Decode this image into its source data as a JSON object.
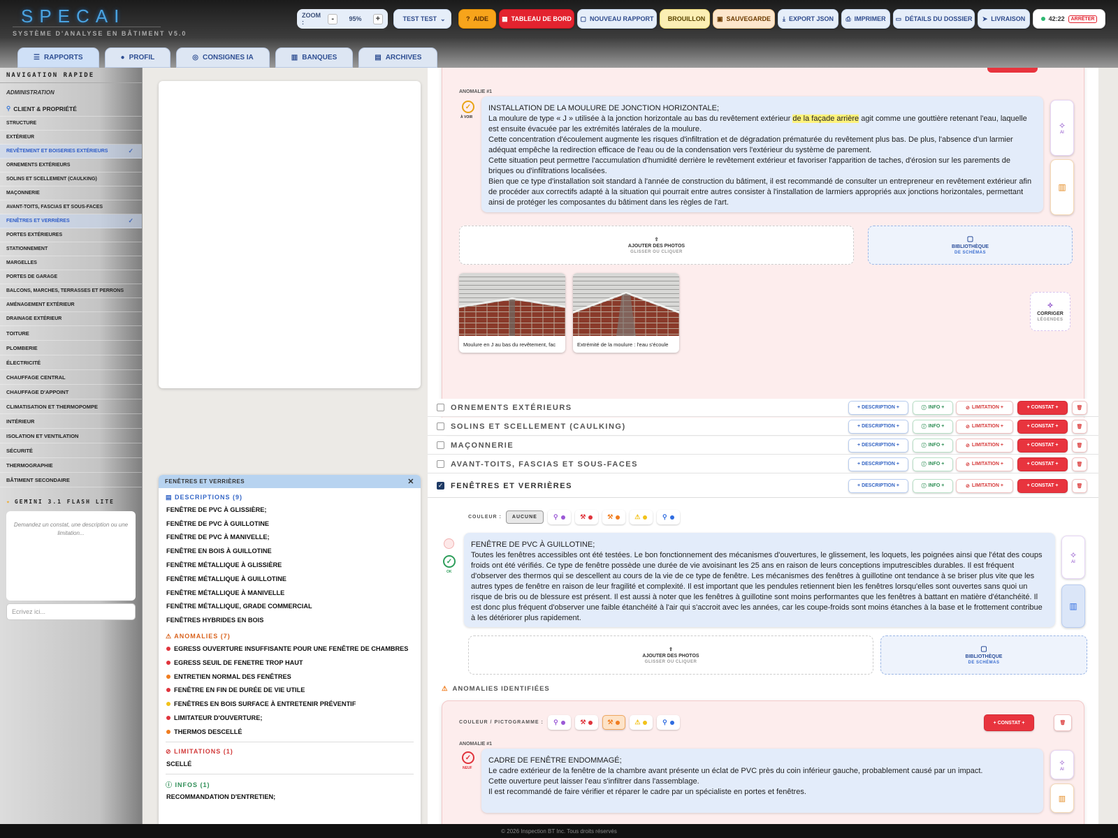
{
  "app": {
    "logo": "SPECAI",
    "subtitle": "SYSTÈME D'ANALYSE EN BÂTIMENT V5.0",
    "footer": "© 2026 Inspection BT Inc. Tous droits réservés"
  },
  "toolbar": {
    "zoom_label": "ZOOM :",
    "zoom_minus": "-",
    "zoom_value": "95%",
    "zoom_plus": "+",
    "user": "TEST TEST",
    "aide": "AIDE",
    "tableau": "TABLEAU DE BORD",
    "nouveau": "NOUVEAU RAPPORT",
    "brouillon": "BROUILLON",
    "sauvegarde": "SAUVEGARDE",
    "export": "EXPORT JSON",
    "imprimer": "IMPRIMER",
    "details": "DÉTAILS DU DOSSIER",
    "livraison": "LIVRAISON",
    "timer": "42:22",
    "arreter": "ARRÊTER"
  },
  "tabs": [
    {
      "label": "RAPPORTS"
    },
    {
      "label": "PROFIL"
    },
    {
      "label": "CONSIGNES IA"
    },
    {
      "label": "BANQUES"
    },
    {
      "label": "ARCHIVES"
    }
  ],
  "sidebar": {
    "title": "NAVIGATION RAPIDE",
    "section": "ADMINISTRATION",
    "items": [
      "CLIENT & PROPRIÉTÉ",
      "STRUCTURE",
      "EXTÉRIEUR",
      "REVÊTEMENT ET BOISERIES EXTÉRIEURS",
      "ORNEMENTS EXTÉRIEURS",
      "SOLINS ET SCELLEMENT (CAULKING)",
      "MAÇONNERIE",
      "AVANT-TOITS, FASCIAS ET SOUS-FACES",
      "FENÊTRES ET VERRIÈRES",
      "PORTES EXTÉRIEURES",
      "STATIONNEMENT",
      "MARGELLES",
      "PORTES DE GARAGE",
      "BALCONS, MARCHES, TERRASSES ET PERRONS",
      "AMÉNAGEMENT EXTÉRIEUR",
      "DRAINAGE EXTÉRIEUR",
      "TOITURE",
      "PLOMBERIE",
      "ÉLECTRICITÉ",
      "CHAUFFAGE CENTRAL",
      "CHAUFFAGE D'APPOINT",
      "CLIMATISATION ET THERMOPOMPE",
      "INTÉRIEUR",
      "ISOLATION ET VENTILATION",
      "SÉCURITÉ",
      "THERMOGRAPHIE",
      "BÂTIMENT SECONDAIRE"
    ],
    "ai_title": "GEMINI 3.1 FLASH LITE",
    "ai_placeholder": "Demandez un constat, une description ou une limitation...",
    "ai_input": "Ecrivez ici..."
  },
  "quick": {
    "title": "FENÊTRES ET VERRIÈRES",
    "desc_title": "DESCRIPTIONS (9)",
    "descriptions": [
      "FENÊTRE DE PVC À GLISSIÈRE;",
      "FENÊTRE DE PVC À GUILLOTINE",
      "FENÊTRE DE PVC À MANIVELLE;",
      "FENÊTRE EN BOIS À GUILLOTINE",
      "FENÊTRE MÉTALLIQUE À GLISSIÈRE",
      "FENÊTRE MÉTALLIQUE À GUILLOTINE",
      "FENÊTRE MÉTALLIQUE À MANIVELLE",
      "FENÊTRE MÉTALLIQUE, GRADE COMMERCIAL",
      "FENÊTRES HYBRIDES EN BOIS"
    ],
    "anom_title": "ANOMALIES (7)",
    "anomalies": [
      {
        "t": "EGRESS OUVERTURE INSUFFISANTE POUR UNE FENÊTRE DE CHAMBRES",
        "c": "#e0343c"
      },
      {
        "t": "EGRESS SEUIL DE FENETRE TROP HAUT",
        "c": "#e0343c"
      },
      {
        "t": "ENTRETIEN NORMAL DES FENÊTRES",
        "c": "#f07d1f"
      },
      {
        "t": "FENÊTRE EN FIN DE DURÉE DE VIE UTILE",
        "c": "#e0343c"
      },
      {
        "t": "FENÊTRES EN BOIS SURFACE À ENTRETENIR PRÉVENTIF",
        "c": "#f2c21a"
      },
      {
        "t": "LIMITATEUR D'OUVERTURE;",
        "c": "#e0343c"
      },
      {
        "t": "THERMOS DESCELLÉ",
        "c": "#f07d1f"
      }
    ],
    "lim_title": "LIMITATIONS (1)",
    "limitations": [
      "SCELLÉ"
    ],
    "info_title": "INFOS (1)",
    "infos": [
      "RECOMMANDATION D'ENTRETIEN;"
    ]
  },
  "card1": {
    "anomalie": "ANOMALIE #1",
    "status": "À VOIR",
    "title": "INSTALLATION DE LA MOULURE DE JONCTION HORIZONTALE;",
    "l1a": "La moulure de type « J » utilisée à la jonction horizontale au bas du revêtement extérieur ",
    "l1hl": "de la façade arrière",
    "l1b": " agit comme une gouttière retenant l'eau, laquelle est ensuite évacuée par les extrémités latérales de la moulure.",
    "l2": "Cette concentration d'écoulement augmente les risques d'infiltration et de dégradation prématurée du revêtement plus bas. De plus, l'absence d'un larmier adéquat empêche la redirection efficace de l'eau ou de la condensation vers l'extérieur du système de parement.",
    "l3": "Cette situation peut permettre l'accumulation d'humidité derrière le revêtement extérieur et favoriser l'apparition de taches, d'érosion sur les parements de briques ou d'infiltrations localisées.",
    "l4": "Bien que ce type d'installation soit standard à l'année de construction du bâtiment, il est recommandé de consulter un entrepreneur en revêtement extérieur afin de procéder aux correctifs adapté à la situation qui pourrait entre autres consister à l'installation de larmiers appropriés aux jonctions horizontales, permettant ainsi de protéger les composantes du bâtiment dans les règles de l'art.",
    "add_photos": "AJOUTER DES PHOTOS",
    "drag": "GLISSER OU CLIQUER",
    "biblio": "BIBLIOTHÈQUE",
    "schemas": "DE SCHÉMAS",
    "cap1": "Moulure en J au bas du revêtement, fac",
    "cap2": "Extrémité de la moulure : l'eau s'écoule",
    "corriger": "CORRIGER",
    "legendes": "LÉGENDES",
    "ai": "AI"
  },
  "rows": [
    {
      "title": "ORNEMENTS EXTÉRIEURS"
    },
    {
      "title": "SOLINS ET SCELLEMENT (CAULKING)"
    },
    {
      "title": "MAÇONNERIE"
    },
    {
      "title": "AVANT-TOITS, FASCIAS ET SOUS-FACES"
    },
    {
      "title": "FENÊTRES ET VERRIÈRES"
    }
  ],
  "pills": {
    "desc": "+ DESCRIPTION +",
    "info": "INFO +",
    "lim": "LIMITATION +",
    "con": "+ CONSTAT +"
  },
  "fenetre": {
    "couleur": "COULEUR :",
    "aucune": "AUCUNE",
    "title": "FENÊTRE DE PVC À GUILLOTINE;",
    "body": "Toutes les fenêtres accessibles ont été testées. Le bon fonctionnement des mécanismes d'ouvertures, le glissement, les loquets, les poignées ainsi que l'état des coups froids ont été vérifiés. Ce type de fenêtre possède une durée de vie avoisinant les 25 ans en raison de leurs conceptions imputrescibles durables. Il est fréquent d'observer des thermos qui se descellent au cours de la vie de ce type de fenêtre. Les mécanismes des fenêtres à guillotine ont tendance à se briser plus vite que les autres types de fenêtre en raison de leur fragilité et complexité. Il est important que les pendules retiennent bien les fenêtres lorsqu'elles sont ouvertes sans quoi un risque de bris ou de blessure est présent. Il est aussi à noter que les fenêtres à guillotine sont moins performantes que les fenêtres à battant en matière d'étanchéité. Il est donc plus fréquent d'observer une faible étanchéité à l'air qui s'accroit avec les années, car les coupe-froids sont moins étanches à la base et le frottement contribue à les détériorer plus rapidement.",
    "ok": "OK",
    "anom_head": "ANOMALIES IDENTIFIÉES",
    "couleur_picto": "COULEUR / PICTOGRAMME :",
    "constat": "+ CONSTAT +",
    "anomalie": "ANOMALIE #1",
    "neuf": "NEUF",
    "a_title": "CADRE DE FENÊTRE ENDOMMAGÉ;",
    "a1": "Le cadre extérieur de la fenêtre de la chambre avant présente un éclat de PVC près du coin inférieur gauche, probablement causé par un impact.",
    "a2": "Cette ouverture peut laisser l'eau s'infiltrer dans l'assemblage.",
    "a3": "Il est recommandé de faire vérifier et réparer le cadre par un spécialiste en portes et fenêtres."
  },
  "colors": {
    "purple": "#9b59d6",
    "red": "#e0343c",
    "orange": "#f07d1f",
    "yellow": "#f2c21a",
    "blue": "#2f6ce0"
  }
}
